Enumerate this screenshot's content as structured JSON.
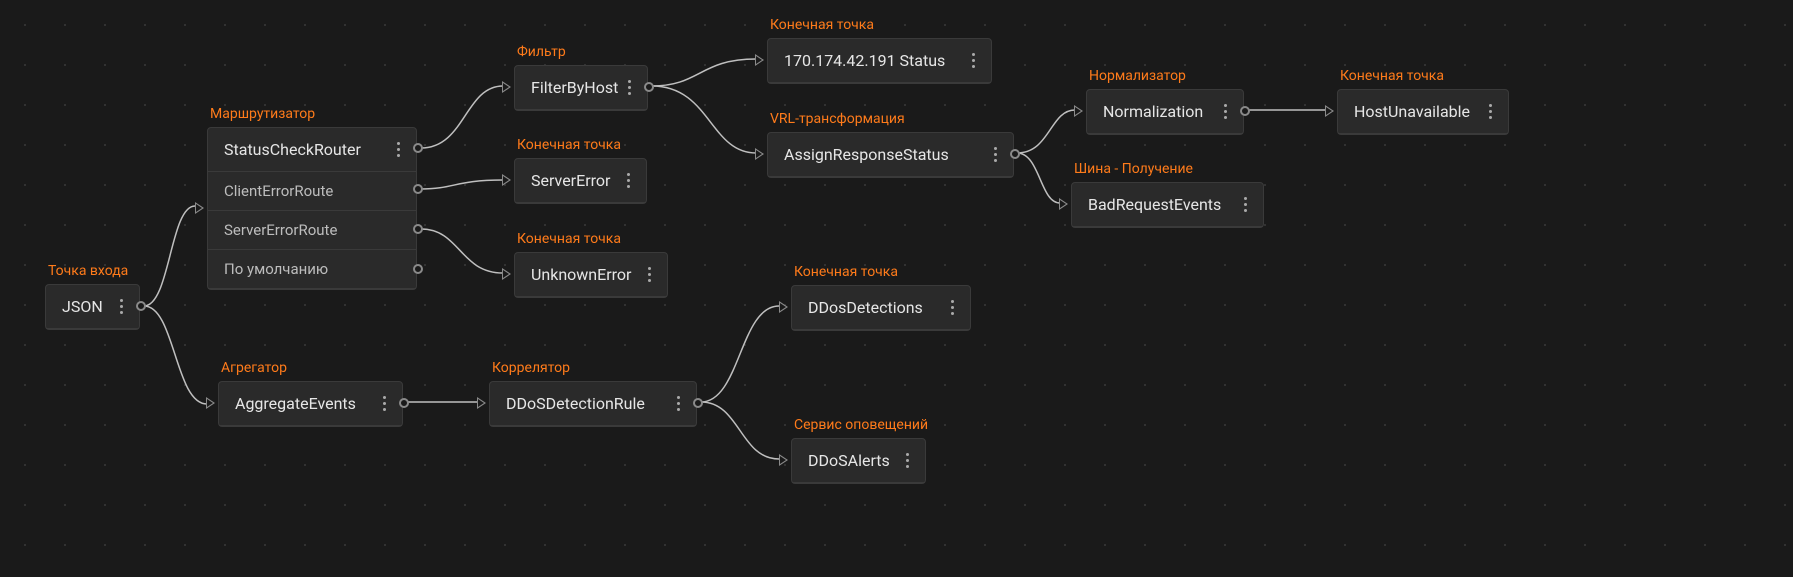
{
  "nodes": {
    "json": {
      "type": "Точка входа",
      "title": "JSON"
    },
    "router": {
      "type": "Маршрутизатор",
      "title": "StatusCheckRouter",
      "routes": [
        "ClientErrorRoute",
        "ServerErrorRoute",
        "По умолчанию"
      ]
    },
    "filter": {
      "type": "Фильтр",
      "title": "FilterByHost"
    },
    "serverError": {
      "type": "Конечная точка",
      "title": "ServerError"
    },
    "unknownError": {
      "type": "Конечная точка",
      "title": "UnknownError"
    },
    "ipStatus": {
      "type": "Конечная точка",
      "title": "170.174.42.191 Status"
    },
    "assign": {
      "type": "VRL-трансформация",
      "title": "AssignResponseStatus"
    },
    "normalize": {
      "type": "Нормализатор",
      "title": "Normalization"
    },
    "hostUnavailable": {
      "type": "Конечная точка",
      "title": "HostUnavailable"
    },
    "badRequest": {
      "type": "Шина - Получение",
      "title": "BadRequestEvents"
    },
    "aggregate": {
      "type": "Агрегатор",
      "title": "AggregateEvents"
    },
    "ddosRule": {
      "type": "Коррелятор",
      "title": "DDoSDetectionRule"
    },
    "ddosDetections": {
      "type": "Конечная точка",
      "title": "DDosDetections"
    },
    "ddosAlerts": {
      "type": "Сервис оповещений",
      "title": "DDoSAlerts"
    }
  }
}
